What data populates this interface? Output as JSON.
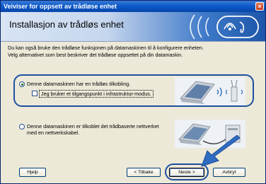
{
  "window": {
    "title": "Veiviser for oppsett av trådløse enhet",
    "close_symbol": "×"
  },
  "header": {
    "title": "Installasjon av trådløs enhet"
  },
  "description": {
    "line1": "Du kan også bruke den trådløse funksjonen på datamaskinen til å konfigurere enheten.",
    "line2": "Velg alternativet som best beskriver det trådløse oppsettet på din datamaskin."
  },
  "options": {
    "option1_label": "Denne datamaskinen har en trådløs tilkobling.",
    "option1_checkbox_label": "Jeg bruker et tilgangspunkt i infrastruktur-modus.",
    "option2_line1": "Denne datamaskinen er tilkoblet det trådbaserte nettverket",
    "option2_line2": "med en nettverkskabel."
  },
  "buttons": {
    "help": "Hjelp",
    "back": "< Tilbake",
    "next": "Neste >",
    "cancel": "Avbryt"
  },
  "state": {
    "option1_selected": true,
    "option2_selected": false,
    "checkbox_checked": false
  },
  "colors": {
    "accent": "#1d4fa0",
    "titlebar": "#0a58ca",
    "dialog_bg": "#ece9d8",
    "arrow": "#2f6cc0"
  },
  "icons": [
    "wireless-waves-icon",
    "laptop-icon",
    "access-point-icon",
    "network-cable-icon",
    "pointer-arrow-icon"
  ]
}
